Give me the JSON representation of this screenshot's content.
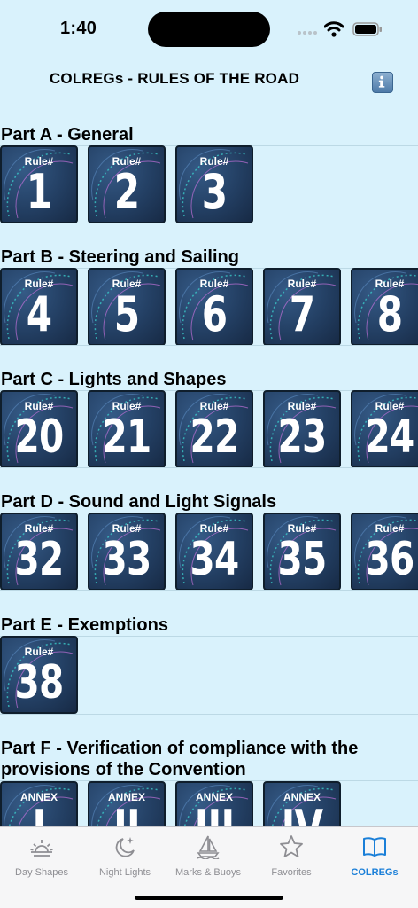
{
  "status": {
    "time": "1:40"
  },
  "nav": {
    "title": "COLREGs - RULES OF THE ROAD",
    "info_icon": "info-icon"
  },
  "sections": [
    {
      "title": "Part A - General",
      "tile_label": "Rule#",
      "tiles": [
        "1",
        "2",
        "3"
      ]
    },
    {
      "title": "Part B - Steering and Sailing",
      "tile_label": "Rule#",
      "tiles": [
        "4",
        "5",
        "6",
        "7",
        "8"
      ]
    },
    {
      "title": "Part C - Lights and Shapes",
      "tile_label": "Rule#",
      "tiles": [
        "20",
        "21",
        "22",
        "23",
        "24"
      ]
    },
    {
      "title": "Part D - Sound and Light Signals",
      "tile_label": "Rule#",
      "tiles": [
        "32",
        "33",
        "34",
        "35",
        "36"
      ]
    },
    {
      "title": "Part E - Exemptions",
      "tile_label": "Rule#",
      "tiles": [
        "38"
      ]
    },
    {
      "title": "Part F - Verification of compliance with the provisions of the Convention",
      "tile_label": "ANNEX",
      "tiles": [
        "I",
        "II",
        "III",
        "IV"
      ]
    }
  ],
  "tabs": [
    {
      "label": "Day Shapes",
      "icon": "sun-horizon-icon",
      "active": false
    },
    {
      "label": "Night Lights",
      "icon": "moon-stars-icon",
      "active": false
    },
    {
      "label": "Marks & Buoys",
      "icon": "sailboat-icon",
      "active": false
    },
    {
      "label": "Favorites",
      "icon": "star-icon",
      "active": false
    },
    {
      "label": "COLREGs",
      "icon": "book-icon",
      "active": true
    }
  ],
  "colors": {
    "background": "#d9f2fc",
    "tile": "#233f63",
    "active_tab": "#1a7fd8",
    "inactive_tab": "#8e8e93"
  }
}
